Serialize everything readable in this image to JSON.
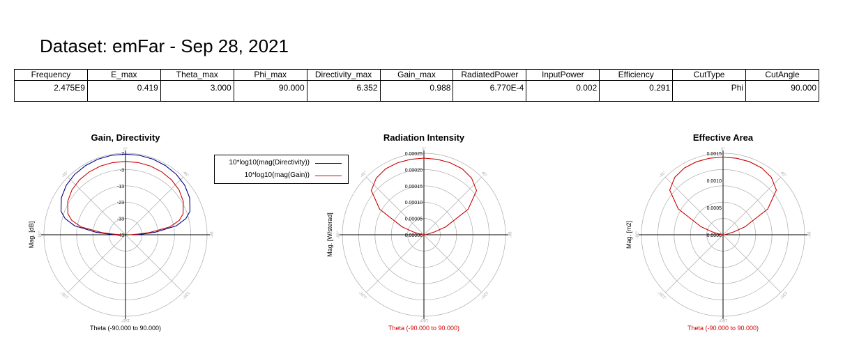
{
  "dataset_title": "Dataset: emFar - Sep 28, 2021",
  "summary_table": {
    "headers": [
      "Frequency",
      "E_max",
      "Theta_max",
      "Phi_max",
      "Directivity_max",
      "Gain_max",
      "RadiatedPower",
      "InputPower",
      "Efficiency",
      "CutType",
      "CutAngle"
    ],
    "values": [
      "2.475E9",
      "0.419",
      "3.000",
      "90.000",
      "6.352",
      "0.988",
      "6.770E-4",
      "0.002",
      "0.291",
      "Phi",
      "90.000"
    ]
  },
  "legend": {
    "items": [
      {
        "label": "10*log10(mag(Directivity))",
        "color": "#000080"
      },
      {
        "label": "10*log10(mag(Gain))",
        "color": "#cc0000"
      }
    ]
  },
  "colors": {
    "directivity": "#000080",
    "gain": "#cc0000",
    "grid": "#aaaaaa",
    "red_text": "#cc0000"
  },
  "chart_data": [
    {
      "type": "polar",
      "title": "Gain, Directivity",
      "ylabel": "Mag. [dB]",
      "xlabel": "Theta (-90.000 to 90.000)",
      "xlabel_color": "#000000",
      "rlim": [
        -53,
        7
      ],
      "r_ticks": [
        "7",
        "-3",
        "-13",
        "-23",
        "-33",
        "-43"
      ],
      "angle_labels": [
        "0°",
        "45°",
        "90°",
        "135°",
        "180°",
        "-135°",
        "-90°",
        "-45°"
      ],
      "grid": true,
      "series": [
        {
          "name": "10*log10(mag(Directivity))",
          "color": "#000080",
          "theta": [
            -90,
            -87,
            -85,
            -80,
            -75,
            -70,
            -60,
            -50,
            -40,
            -30,
            -20,
            -10,
            0,
            10,
            20,
            30,
            40,
            50,
            60,
            70,
            75,
            80,
            85,
            87,
            90
          ],
          "values": [
            -45,
            -39,
            -31,
            -15,
            -7,
            -2.5,
            1.5,
            3.8,
            5.1,
            5.8,
            6.2,
            6.35,
            6.35,
            6.35,
            6.2,
            5.8,
            5.1,
            3.8,
            1.5,
            -2.5,
            -7,
            -15,
            -31,
            -39,
            -45
          ]
        },
        {
          "name": "10*log10(mag(Gain))",
          "color": "#cc0000",
          "theta": [
            -90,
            -87,
            -85,
            -80,
            -75,
            -70,
            -60,
            -50,
            -40,
            -30,
            -20,
            -10,
            0,
            10,
            20,
            30,
            40,
            50,
            60,
            70,
            75,
            80,
            85,
            87,
            90
          ],
          "values": [
            -50,
            -44,
            -36,
            -20,
            -12,
            -7.9,
            -3.9,
            -1.6,
            -0.3,
            0.4,
            0.8,
            0.95,
            0.988,
            0.95,
            0.8,
            0.4,
            -0.3,
            -1.6,
            -3.9,
            -7.9,
            -12,
            -20,
            -36,
            -44,
            -50
          ]
        }
      ]
    },
    {
      "type": "polar",
      "title": "Radiation Intensity",
      "ylabel": "Mag. [W/sterad]",
      "xlabel": "Theta (-90.000 to 90.000)",
      "xlabel_color": "#cc0000",
      "rlim": [
        0,
        0.00025
      ],
      "r_ticks": [
        "0.00025",
        "0.00020",
        "0.00015",
        "0.00010",
        "0.00005",
        "0.00000"
      ],
      "angle_labels": [
        "0°",
        "45°",
        "90°",
        "135°",
        "180°",
        "-135°",
        "-90°",
        "-45°"
      ],
      "grid": true,
      "series": [
        {
          "name": "",
          "color": "#cc0000",
          "theta": [
            -90,
            -87,
            -85,
            -80,
            -75,
            -70,
            -60,
            -50,
            -40,
            -30,
            -20,
            -10,
            0,
            10,
            20,
            30,
            40,
            50,
            60,
            70,
            75,
            80,
            85,
            87,
            90
          ],
          "values": [
            0,
            4e-06,
            5e-06,
            1.2e-05,
            3.4e-05,
            7.12e-05,
            0.0001565,
            0.0002107,
            0.000227,
            0.000234,
            0.0002351,
            0.000235,
            0.000235,
            0.000235,
            0.0002351,
            0.000234,
            0.000227,
            0.0002107,
            0.0001565,
            7.12e-05,
            3.4e-05,
            1.2e-05,
            5e-06,
            4e-06,
            0
          ]
        }
      ]
    },
    {
      "type": "polar",
      "title": "Effective Area",
      "ylabel": "Mag. [m2]",
      "xlabel": "Theta (-90.000 to 90.000)",
      "xlabel_color": "#cc0000",
      "rlim": [
        0,
        0.0015
      ],
      "r_ticks": [
        "0.0015",
        "0.0010",
        "0.0005",
        "0.0000"
      ],
      "angle_labels": [
        "0°",
        "45°",
        "90°",
        "135°",
        "180°",
        "-135°",
        "-90°",
        "-45°"
      ],
      "grid": true,
      "series": [
        {
          "name": "",
          "color": "#cc0000",
          "theta": [
            -90,
            -87,
            -85,
            -80,
            -75,
            -70,
            -60,
            -50,
            -40,
            -30,
            -20,
            -10,
            0,
            10,
            20,
            30,
            40,
            50,
            60,
            70,
            75,
            80,
            85,
            87,
            90
          ],
          "values": [
            0,
            3e-05,
            3.5e-05,
            8e-05,
            0.0002,
            0.00043,
            0.00095,
            0.00128,
            0.00138,
            0.00142,
            0.00143,
            0.00143,
            0.00143,
            0.00143,
            0.00143,
            0.00142,
            0.00138,
            0.00128,
            0.00095,
            0.00043,
            0.0002,
            8e-05,
            3.5e-05,
            3e-05,
            0
          ]
        }
      ]
    }
  ]
}
